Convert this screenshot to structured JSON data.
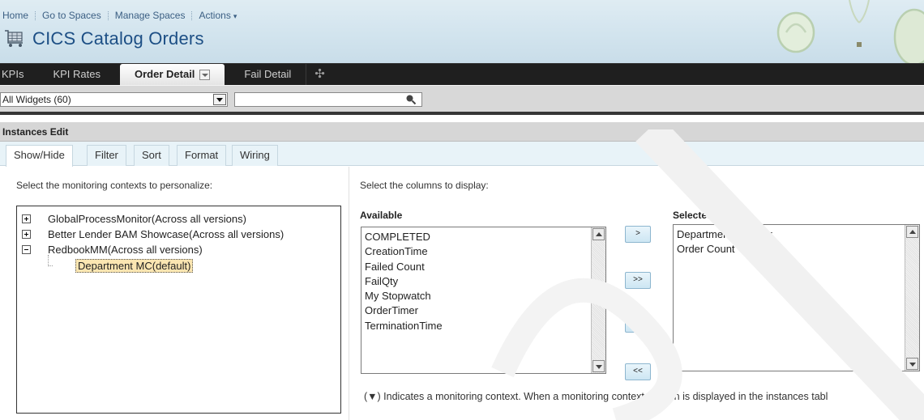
{
  "topnav": {
    "items": [
      "Home",
      "Go to Spaces",
      "Manage Spaces",
      "Actions"
    ],
    "actions_caret": "▾"
  },
  "app": {
    "title": "CICS Catalog Orders"
  },
  "tabs": {
    "items": [
      "KPIs",
      "KPI Rates",
      "Order Detail",
      "Fail Detail"
    ],
    "active": "Order Detail",
    "add_icon": "✣"
  },
  "widgetbar": {
    "selected": "All Widgets (60)",
    "search_placeholder": ""
  },
  "edit": {
    "header": "Instances Edit",
    "subtabs": [
      "Show/Hide",
      "Filter",
      "Sort",
      "Format",
      "Wiring"
    ],
    "active_subtab": "Show/Hide",
    "left_hint": "Select the monitoring contexts to personalize:",
    "right_hint": "Select the columns to display:",
    "tree": {
      "nodes": [
        {
          "label": "GlobalProcessMonitor(Across all versions)",
          "expanded": false
        },
        {
          "label": "Better Lender BAM Showcase(Across all versions)",
          "expanded": false
        },
        {
          "label": "RedbookMM(Across all versions)",
          "expanded": true
        }
      ],
      "child": "Department MC(default)"
    },
    "available_label": "Available",
    "selected_label": "Selected",
    "required_mark": "*",
    "available": [
      "COMPLETED",
      "CreationTime",
      "Failed Count",
      "FailQty",
      "My Stopwatch",
      "OrderTimer",
      "TerminationTime"
    ],
    "selected": [
      "Department Number",
      "Order Count"
    ],
    "buttons": {
      "move_right": ">",
      "move_all_right": ">>",
      "move_left": "<",
      "move_all_left": "<<"
    },
    "footnote": "(▼) Indicates a monitoring context. When a monitoring context column is displayed in the instances tabl"
  },
  "colors": {
    "title": "#1d4f85",
    "tabbar": "#1f1f1f",
    "subtab_bg": "#e8f3f8",
    "selection": "#fbe6b2"
  }
}
